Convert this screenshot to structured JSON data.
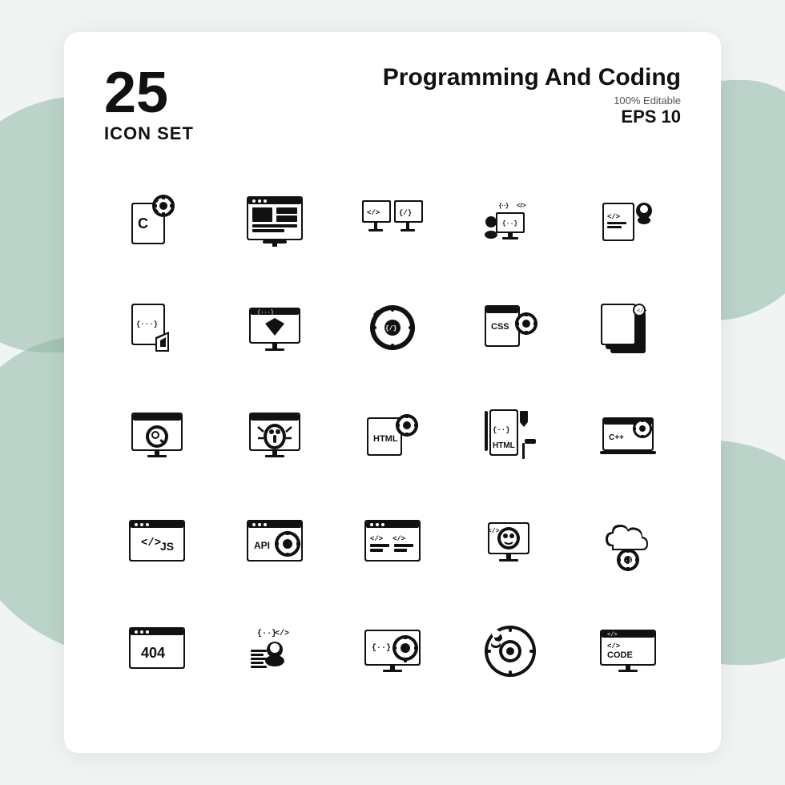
{
  "header": {
    "number": "25",
    "icon_set_label": "ICON SET",
    "title": "Programming And Coding",
    "editable": "100% Editable",
    "eps": "EPS 10"
  },
  "icons": [
    {
      "name": "c-programming-file",
      "row": 1,
      "col": 1
    },
    {
      "name": "web-layout",
      "row": 1,
      "col": 2
    },
    {
      "name": "dual-monitor-code",
      "row": 1,
      "col": 3
    },
    {
      "name": "remote-coding",
      "row": 1,
      "col": 4
    },
    {
      "name": "code-review",
      "row": 1,
      "col": 5
    },
    {
      "name": "ruby-code-file",
      "row": 2,
      "col": 1
    },
    {
      "name": "diamond-monitor",
      "row": 2,
      "col": 2
    },
    {
      "name": "code-gear",
      "row": 2,
      "col": 3
    },
    {
      "name": "css-settings",
      "row": 2,
      "col": 4
    },
    {
      "name": "code-layers",
      "row": 2,
      "col": 5
    },
    {
      "name": "search-monitor",
      "row": 3,
      "col": 1
    },
    {
      "name": "bug-monitor",
      "row": 3,
      "col": 2
    },
    {
      "name": "html-gear",
      "row": 3,
      "col": 3
    },
    {
      "name": "html-bookmark",
      "row": 3,
      "col": 4
    },
    {
      "name": "cpp-code",
      "row": 3,
      "col": 5
    },
    {
      "name": "js-browser",
      "row": 4,
      "col": 1
    },
    {
      "name": "api-settings",
      "row": 4,
      "col": 2
    },
    {
      "name": "code-browser",
      "row": 4,
      "col": 3
    },
    {
      "name": "robot-monitor",
      "row": 4,
      "col": 4
    },
    {
      "name": "cloud-settings",
      "row": 4,
      "col": 5
    },
    {
      "name": "404-page",
      "row": 5,
      "col": 1
    },
    {
      "name": "developer-person",
      "row": 5,
      "col": 2
    },
    {
      "name": "monitor-gear",
      "row": 5,
      "col": 3
    },
    {
      "name": "coder-gear",
      "row": 5,
      "col": 4
    },
    {
      "name": "code-monitor",
      "row": 5,
      "col": 5
    }
  ]
}
